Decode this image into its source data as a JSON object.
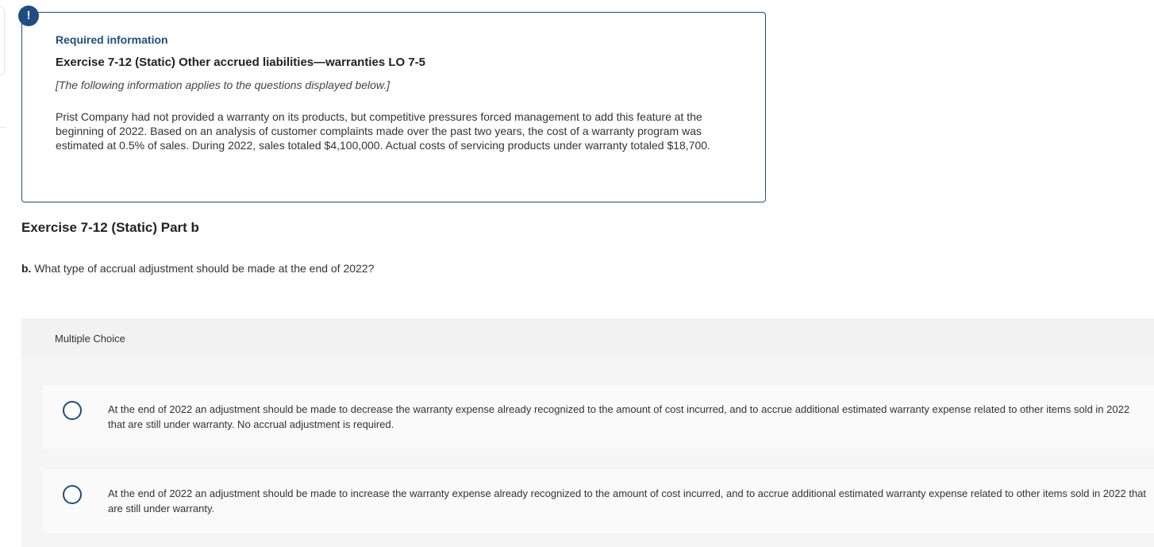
{
  "alert": {
    "glyph": "!"
  },
  "info": {
    "heading": "Required information",
    "exercise_title": "Exercise 7-12 (Static) Other accrued liabilities—warranties LO 7-5",
    "note": "[The following information applies to the questions displayed below.]",
    "body": "Prist Company had not provided a warranty on its products, but competitive pressures forced management to add this feature at the beginning of 2022. Based on an analysis of customer complaints made over the past two years, the cost of a warranty program was estimated at 0.5% of sales. During 2022, sales totaled $4,100,000. Actual costs of servicing products under warranty totaled $18,700."
  },
  "part": {
    "title": "Exercise 7-12 (Static) Part b"
  },
  "question": {
    "label": "b.",
    "text": " What type of accrual adjustment should be made at the end of 2022?"
  },
  "multiple_choice": {
    "header": "Multiple Choice",
    "accent_color": "#1e4d83",
    "options": [
      {
        "text": "At the end of 2022 an adjustment should be made to decrease the warranty expense already recognized to the amount of cost incurred, and to accrue additional estimated warranty expense related to other items sold in 2022 that are still under warranty. No accrual adjustment is required.",
        "selected": false
      },
      {
        "text": "At the end of 2022 an adjustment should be made to increase the warranty expense already recognized to the amount of cost incurred, and to accrue additional estimated warranty expense related to other items sold in 2022 that are still under warranty.",
        "selected": false
      }
    ]
  }
}
